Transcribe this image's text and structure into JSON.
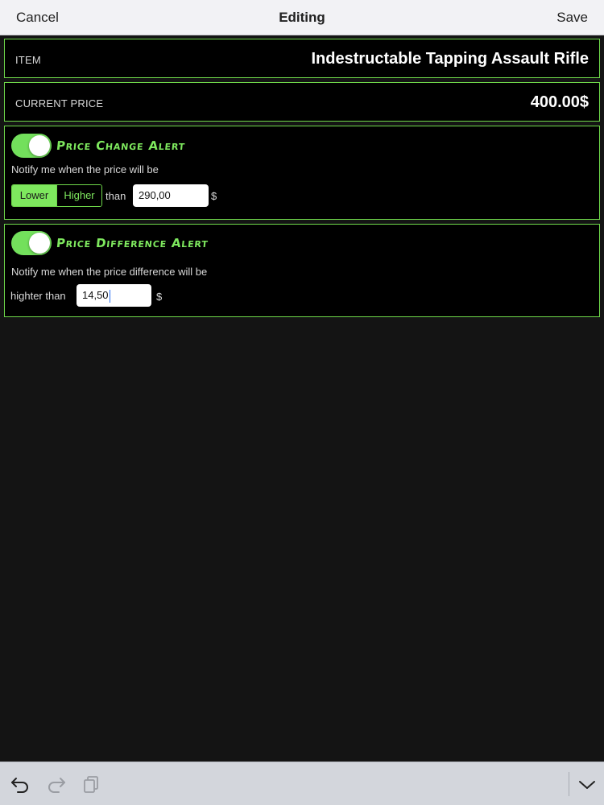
{
  "navbar": {
    "cancel_label": "Cancel",
    "title": "Editing",
    "save_label": "Save"
  },
  "item_row": {
    "label": "ITEM",
    "value": "Indestructable Tapping Assault Rifle"
  },
  "price_row": {
    "label": "CURRENT PRICE",
    "value": "400.00$"
  },
  "price_change_alert": {
    "enabled": true,
    "title": "Price Change Alert",
    "description": "Notify me when the price will be",
    "direction_options": [
      "Lower",
      "Higher"
    ],
    "selected_direction": "Lower",
    "than_label": "than",
    "value": "290,00",
    "currency": "$"
  },
  "price_difference_alert": {
    "enabled": true,
    "title": "Price Difference Alert",
    "description": "Notify me when the price difference will be",
    "prefix_label": "highter than",
    "value": "14,50",
    "currency": "$"
  },
  "toolbar": {
    "icons": [
      "undo-icon",
      "redo-icon",
      "paste-icon",
      "hide-keyboard-icon"
    ]
  },
  "colors": {
    "accent": "#7ee85e",
    "card_border": "#6fd94a",
    "background": "#141414",
    "card_background": "#000000"
  }
}
